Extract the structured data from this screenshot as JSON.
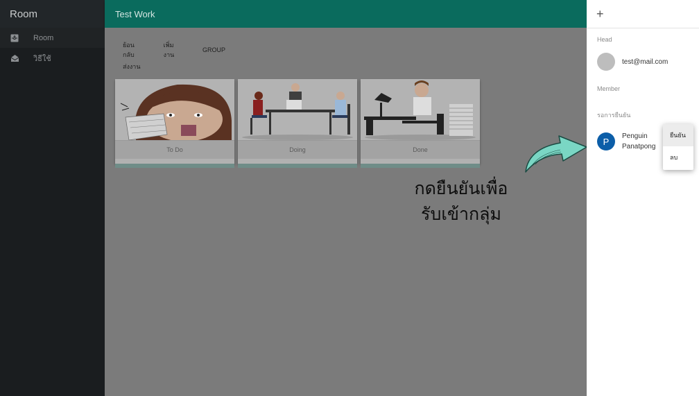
{
  "sidebar": {
    "title": "Room",
    "items": [
      {
        "label": "Room",
        "icon": "inbox-icon",
        "active": true
      },
      {
        "label": "วิธีใช้",
        "icon": "open-envelope-icon",
        "active": false
      }
    ]
  },
  "appbar": {
    "title": "Test Work"
  },
  "toolbar": {
    "back_label": "ย้อนกลับ",
    "add_work_label": "เพิ่มงาน",
    "group_label": "GROUP",
    "send_label": "ส่งงาน"
  },
  "cards": [
    {
      "label": "To Do"
    },
    {
      "label": "Doing"
    },
    {
      "label": "Done"
    }
  ],
  "annotation": {
    "line1": "กดยืนยันเพื่อ",
    "line2": "รับเข้ากลุ่ม"
  },
  "drawer": {
    "add_icon": "plus-icon",
    "head_label": "Head",
    "head_user": "test@mail.com",
    "member_label": "Member",
    "pending_label": "รอการยืนยัน",
    "pending_user": {
      "initial": "P",
      "first": "Penguin",
      "last": "Panatpong"
    },
    "menu": {
      "confirm": "ยืนยัน",
      "delete": "ลบ"
    }
  },
  "colors": {
    "appbar": "#0a6b5d",
    "avatar": "#0c5ea8",
    "arrow": "#7ad6c4"
  }
}
